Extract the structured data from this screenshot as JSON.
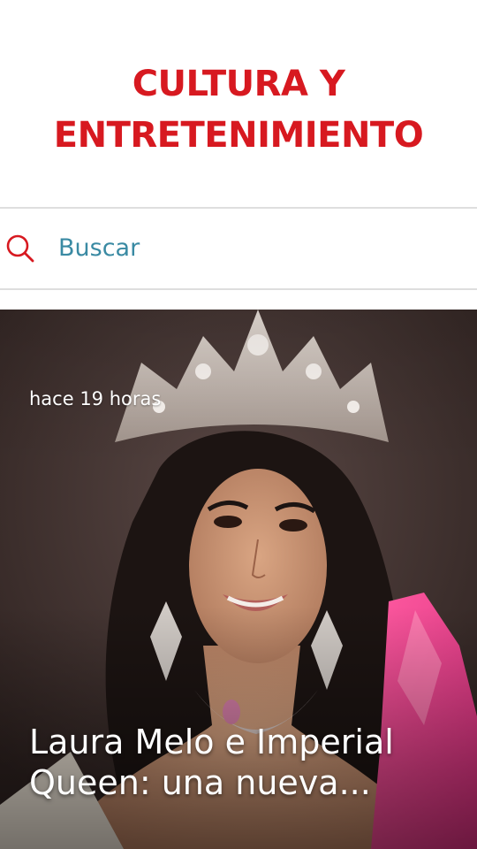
{
  "header": {
    "section_title": "CULTURA Y ENTRETENIMIENTO",
    "accent_color": "#d71920"
  },
  "search": {
    "label": "Buscar",
    "icon": "search-icon",
    "text_color": "#3a8aa3"
  },
  "featured_article": {
    "time_ago": "hace 19 horas",
    "headline": "Laura Melo e Imperial Queen: una nueva...",
    "image": "photo of a smiling woman with long dark hair wearing a large jeweled crown and chandelier earrings, holding pink flowers"
  }
}
